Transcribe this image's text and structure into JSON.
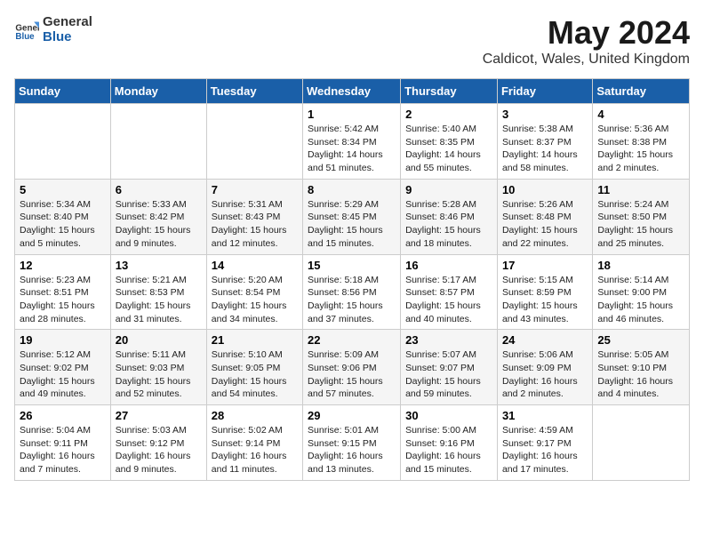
{
  "logo": {
    "general": "General",
    "blue": "Blue"
  },
  "title": "May 2024",
  "location": "Caldicot, Wales, United Kingdom",
  "weekdays": [
    "Sunday",
    "Monday",
    "Tuesday",
    "Wednesday",
    "Thursday",
    "Friday",
    "Saturday"
  ],
  "weeks": [
    [
      {
        "day": "",
        "info": ""
      },
      {
        "day": "",
        "info": ""
      },
      {
        "day": "",
        "info": ""
      },
      {
        "day": "1",
        "info": "Sunrise: 5:42 AM\nSunset: 8:34 PM\nDaylight: 14 hours\nand 51 minutes."
      },
      {
        "day": "2",
        "info": "Sunrise: 5:40 AM\nSunset: 8:35 PM\nDaylight: 14 hours\nand 55 minutes."
      },
      {
        "day": "3",
        "info": "Sunrise: 5:38 AM\nSunset: 8:37 PM\nDaylight: 14 hours\nand 58 minutes."
      },
      {
        "day": "4",
        "info": "Sunrise: 5:36 AM\nSunset: 8:38 PM\nDaylight: 15 hours\nand 2 minutes."
      }
    ],
    [
      {
        "day": "5",
        "info": "Sunrise: 5:34 AM\nSunset: 8:40 PM\nDaylight: 15 hours\nand 5 minutes."
      },
      {
        "day": "6",
        "info": "Sunrise: 5:33 AM\nSunset: 8:42 PM\nDaylight: 15 hours\nand 9 minutes."
      },
      {
        "day": "7",
        "info": "Sunrise: 5:31 AM\nSunset: 8:43 PM\nDaylight: 15 hours\nand 12 minutes."
      },
      {
        "day": "8",
        "info": "Sunrise: 5:29 AM\nSunset: 8:45 PM\nDaylight: 15 hours\nand 15 minutes."
      },
      {
        "day": "9",
        "info": "Sunrise: 5:28 AM\nSunset: 8:46 PM\nDaylight: 15 hours\nand 18 minutes."
      },
      {
        "day": "10",
        "info": "Sunrise: 5:26 AM\nSunset: 8:48 PM\nDaylight: 15 hours\nand 22 minutes."
      },
      {
        "day": "11",
        "info": "Sunrise: 5:24 AM\nSunset: 8:50 PM\nDaylight: 15 hours\nand 25 minutes."
      }
    ],
    [
      {
        "day": "12",
        "info": "Sunrise: 5:23 AM\nSunset: 8:51 PM\nDaylight: 15 hours\nand 28 minutes."
      },
      {
        "day": "13",
        "info": "Sunrise: 5:21 AM\nSunset: 8:53 PM\nDaylight: 15 hours\nand 31 minutes."
      },
      {
        "day": "14",
        "info": "Sunrise: 5:20 AM\nSunset: 8:54 PM\nDaylight: 15 hours\nand 34 minutes."
      },
      {
        "day": "15",
        "info": "Sunrise: 5:18 AM\nSunset: 8:56 PM\nDaylight: 15 hours\nand 37 minutes."
      },
      {
        "day": "16",
        "info": "Sunrise: 5:17 AM\nSunset: 8:57 PM\nDaylight: 15 hours\nand 40 minutes."
      },
      {
        "day": "17",
        "info": "Sunrise: 5:15 AM\nSunset: 8:59 PM\nDaylight: 15 hours\nand 43 minutes."
      },
      {
        "day": "18",
        "info": "Sunrise: 5:14 AM\nSunset: 9:00 PM\nDaylight: 15 hours\nand 46 minutes."
      }
    ],
    [
      {
        "day": "19",
        "info": "Sunrise: 5:12 AM\nSunset: 9:02 PM\nDaylight: 15 hours\nand 49 minutes."
      },
      {
        "day": "20",
        "info": "Sunrise: 5:11 AM\nSunset: 9:03 PM\nDaylight: 15 hours\nand 52 minutes."
      },
      {
        "day": "21",
        "info": "Sunrise: 5:10 AM\nSunset: 9:05 PM\nDaylight: 15 hours\nand 54 minutes."
      },
      {
        "day": "22",
        "info": "Sunrise: 5:09 AM\nSunset: 9:06 PM\nDaylight: 15 hours\nand 57 minutes."
      },
      {
        "day": "23",
        "info": "Sunrise: 5:07 AM\nSunset: 9:07 PM\nDaylight: 15 hours\nand 59 minutes."
      },
      {
        "day": "24",
        "info": "Sunrise: 5:06 AM\nSunset: 9:09 PM\nDaylight: 16 hours\nand 2 minutes."
      },
      {
        "day": "25",
        "info": "Sunrise: 5:05 AM\nSunset: 9:10 PM\nDaylight: 16 hours\nand 4 minutes."
      }
    ],
    [
      {
        "day": "26",
        "info": "Sunrise: 5:04 AM\nSunset: 9:11 PM\nDaylight: 16 hours\nand 7 minutes."
      },
      {
        "day": "27",
        "info": "Sunrise: 5:03 AM\nSunset: 9:12 PM\nDaylight: 16 hours\nand 9 minutes."
      },
      {
        "day": "28",
        "info": "Sunrise: 5:02 AM\nSunset: 9:14 PM\nDaylight: 16 hours\nand 11 minutes."
      },
      {
        "day": "29",
        "info": "Sunrise: 5:01 AM\nSunset: 9:15 PM\nDaylight: 16 hours\nand 13 minutes."
      },
      {
        "day": "30",
        "info": "Sunrise: 5:00 AM\nSunset: 9:16 PM\nDaylight: 16 hours\nand 15 minutes."
      },
      {
        "day": "31",
        "info": "Sunrise: 4:59 AM\nSunset: 9:17 PM\nDaylight: 16 hours\nand 17 minutes."
      },
      {
        "day": "",
        "info": ""
      }
    ]
  ]
}
